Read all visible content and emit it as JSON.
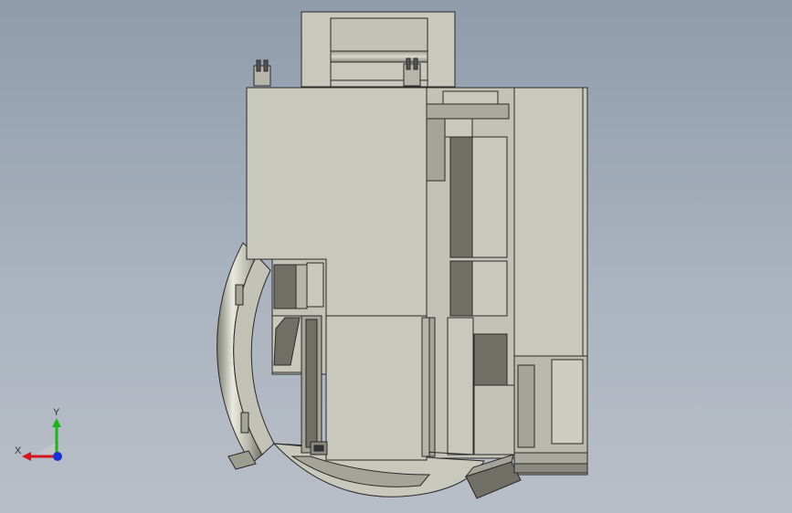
{
  "scene": {
    "background_top": "#8f9cab",
    "background_bottom": "#b9bfc8",
    "part_fill": "#c8c8bc",
    "part_shade": "#a4a499",
    "part_dark": "#6f6f66",
    "edge_color": "#2a2a2a"
  },
  "triad": {
    "x_label": "X",
    "y_label": "Y",
    "x_color": "#d8141c",
    "y_color": "#1db31d",
    "z_color": "#1b2fd6"
  }
}
